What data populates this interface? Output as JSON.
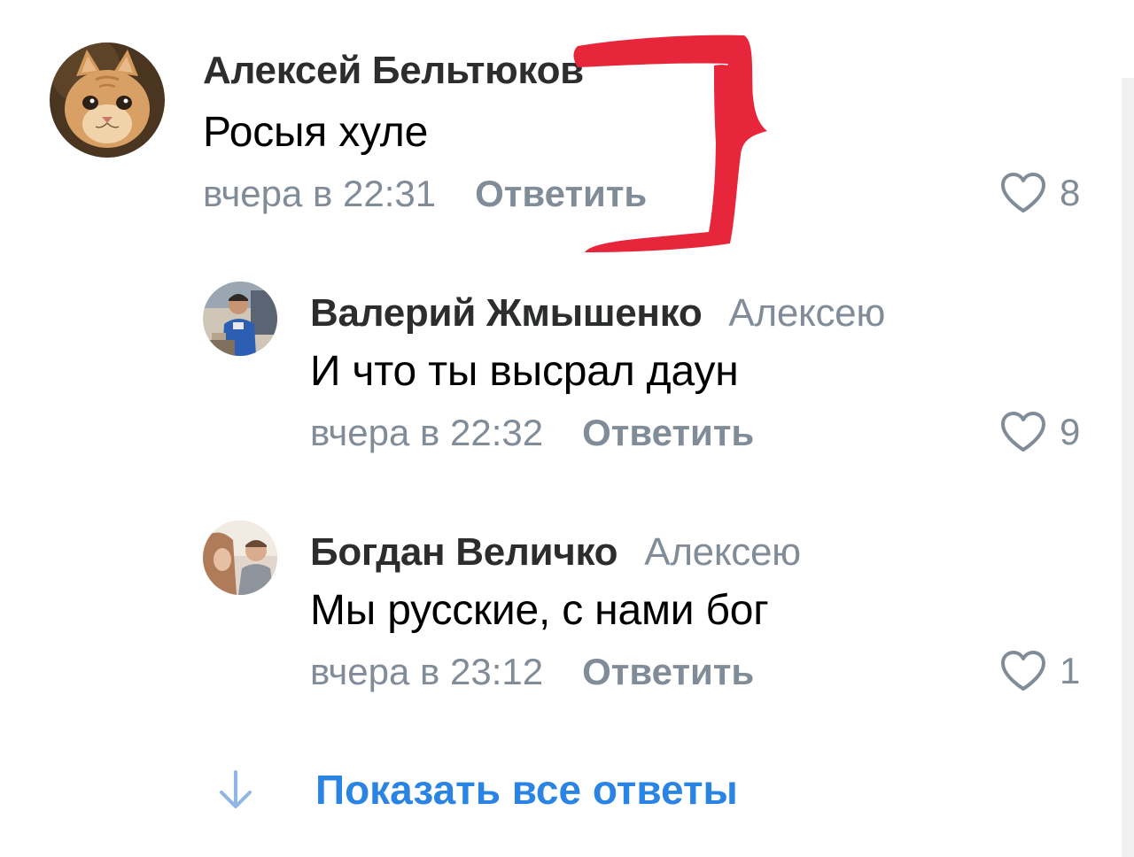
{
  "comments": [
    {
      "author": "Алексей Бельтюков",
      "reply_to": "",
      "text": "Росыя хуле",
      "time": "вчера в 22:31",
      "reply_label": "Ответить",
      "likes": "8",
      "avatar": "cat-avatar"
    },
    {
      "author": "Валерий Жмышенко",
      "reply_to": "Алексею",
      "text": "И что ты высрал даун",
      "time": "вчера в 22:32",
      "reply_label": "Ответить",
      "likes": "9",
      "avatar": "user-photo-avatar"
    },
    {
      "author": "Богдан Величко",
      "reply_to": "Алексею",
      "text": "Мы русские, с нами бог",
      "time": "вчера в 23:12",
      "reply_label": "Ответить",
      "likes": "1",
      "avatar": "user-photo-avatar"
    }
  ],
  "show_all_replies": {
    "label": "Показать все ответы",
    "icon": "arrow-down-icon"
  },
  "annotation": {
    "color": "#e8263b",
    "shape": "red-bracket-scribble"
  },
  "colors": {
    "author": "#2c2d2e",
    "secondary": "#818c99",
    "link": "#2a84e3"
  }
}
